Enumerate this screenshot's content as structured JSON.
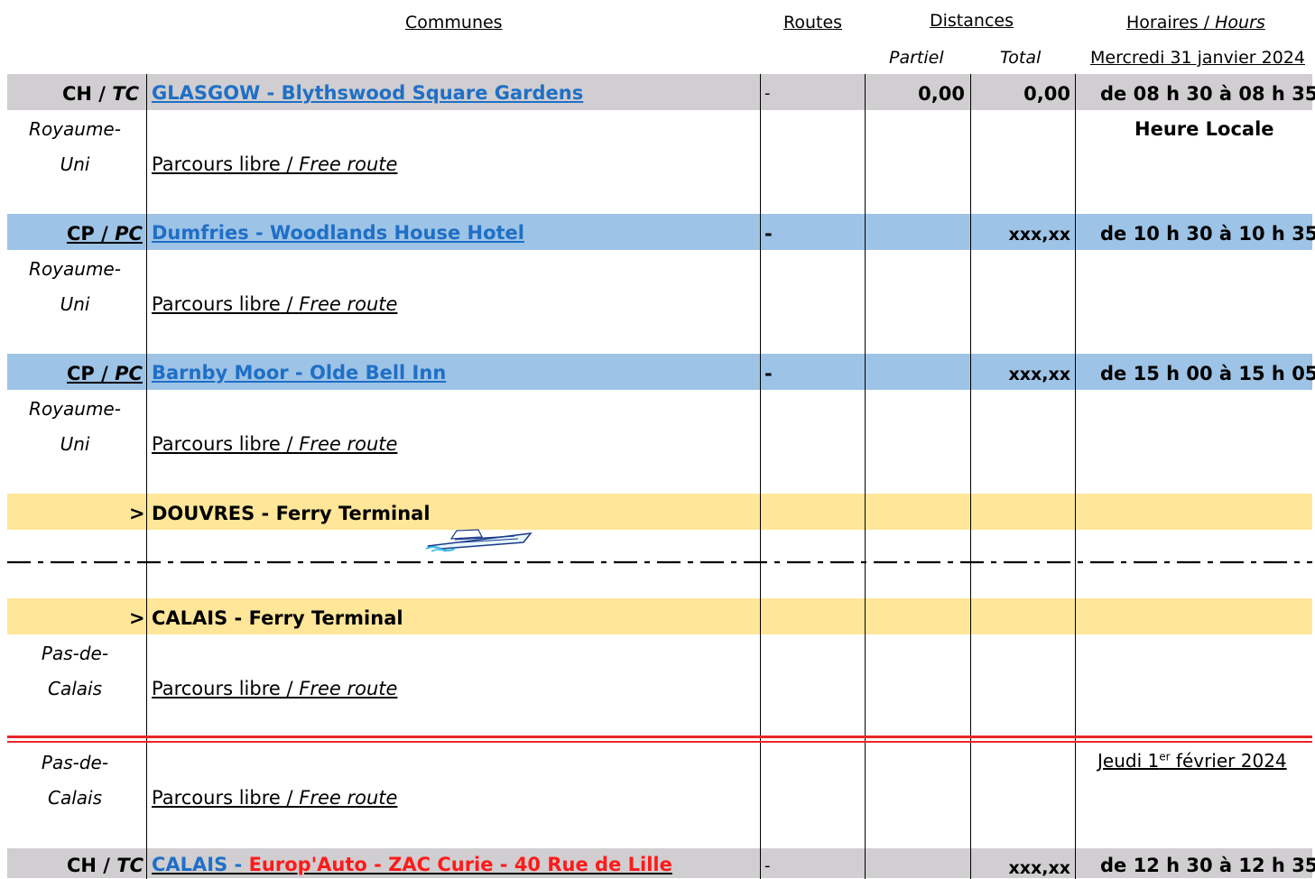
{
  "header": {
    "communes": "Communes",
    "routes": "Routes",
    "distances": "Distances",
    "horaires": "Horaires /",
    "hours": "Hours",
    "partiel": "Partiel",
    "total": "Total",
    "date1": "Mercredi 31 janvier 2024"
  },
  "rows": {
    "r1": {
      "code": "CH /",
      "code_it": "TC",
      "place": "GLASGOW - Blythswood Square Gardens",
      "route": "-",
      "partiel": "0,00",
      "total": "0,00",
      "time": "de 08 h 30 à 08 h 35",
      "note": "Heure Locale"
    },
    "r2": {
      "code": "CP /",
      "code_it": "PC",
      "place": "Dumfries - Woodlands House Hotel",
      "route": "-",
      "total": "xxx,xx",
      "time": "de 10 h 30 à 10 h 35"
    },
    "r3": {
      "code": "CP /",
      "code_it": "PC",
      "place": "Barnby Moor - Olde Bell Inn",
      "route": "-",
      "total": "xxx,xx",
      "time": "de 15 h 00 à 15 h 05"
    },
    "r4": {
      "marker": ">",
      "place": "DOUVRES - Ferry Terminal"
    },
    "r5": {
      "marker": ">",
      "place": "CALAIS - Ferry Terminal"
    },
    "r6": {
      "code": "CH /",
      "code_it": "TC",
      "place_a": "CALAIS - ",
      "place_b": "Europ'Auto - ZAC Curie - 40 Rue de Lille",
      "route": "-",
      "total": "xxx,xx",
      "time": "de 12 h 30 à 12 h 35"
    }
  },
  "segments": {
    "country_uk_1": "Royaume-",
    "country_uk_2": "Uni",
    "country_fr_1": "Pas-de-",
    "country_fr_2": "Calais",
    "route_a": "Parcours libre /",
    "route_b": "Free route"
  },
  "date2": {
    "prefix": "Jeudi 1",
    "sup": "er",
    "suffix": " février 2024"
  },
  "icons": {
    "ferry": "ferry-boat-icon"
  },
  "colors": {
    "gray_band": "#d0ced0",
    "blue_band": "#9dc3e6",
    "yellow_band": "#ffe699",
    "link": "#1f6fc6",
    "red": "#ff1a1a"
  }
}
